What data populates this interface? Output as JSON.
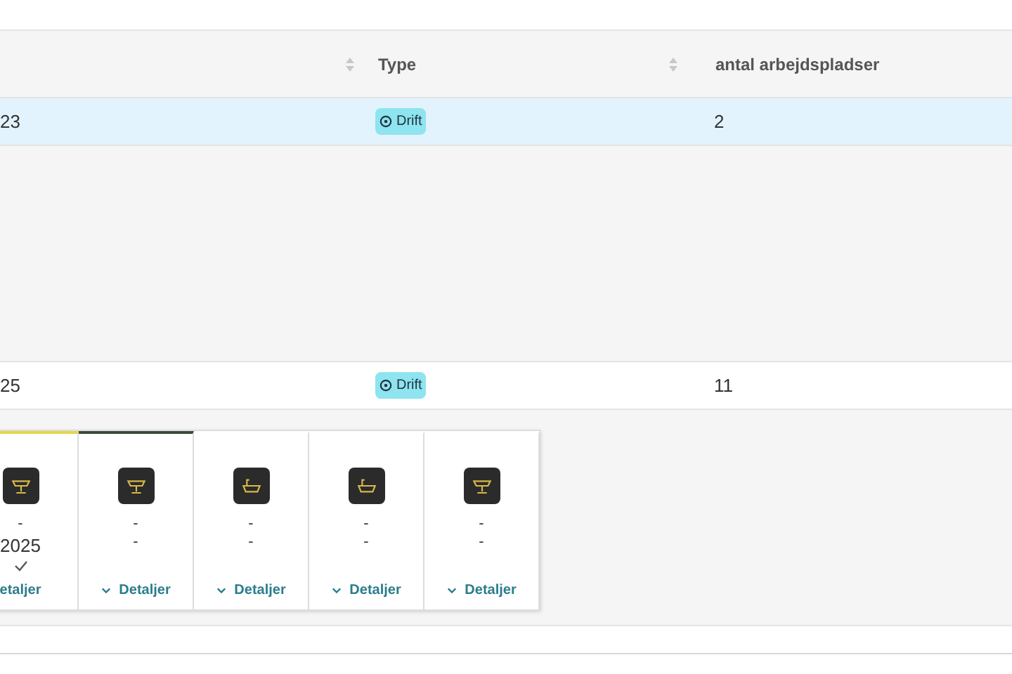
{
  "table": {
    "columns": [
      {
        "sortable": true
      },
      {
        "label": "Type",
        "sortable": true
      },
      {
        "label": "antal arbejdspladser"
      }
    ],
    "rows": [
      {
        "id_cell": "23",
        "type": "Drift",
        "count": "2",
        "selected": true,
        "details": []
      },
      {
        "id_cell": "25",
        "type": "Drift",
        "count": "11",
        "selected": false,
        "details": [
          {
            "kind": "bowl",
            "color": "#e6d54a",
            "lines": [
              "-",
              "2025"
            ],
            "done": true,
            "link": "etaljer",
            "chevron": false
          },
          {
            "kind": "bowl",
            "color": "#3a4a3a",
            "lines": [
              "-",
              "-"
            ],
            "done": false,
            "link": "Detaljer",
            "chevron": true
          },
          {
            "kind": "bath",
            "lines": [
              "-",
              "-"
            ],
            "done": false,
            "link": "Detaljer",
            "chevron": true
          },
          {
            "kind": "bath",
            "lines": [
              "-",
              "-"
            ],
            "done": false,
            "link": "Detaljer",
            "chevron": true
          },
          {
            "kind": "bowl",
            "lines": [
              "-",
              "-"
            ],
            "done": false,
            "link": "Detaljer",
            "chevron": true
          }
        ]
      }
    ]
  }
}
